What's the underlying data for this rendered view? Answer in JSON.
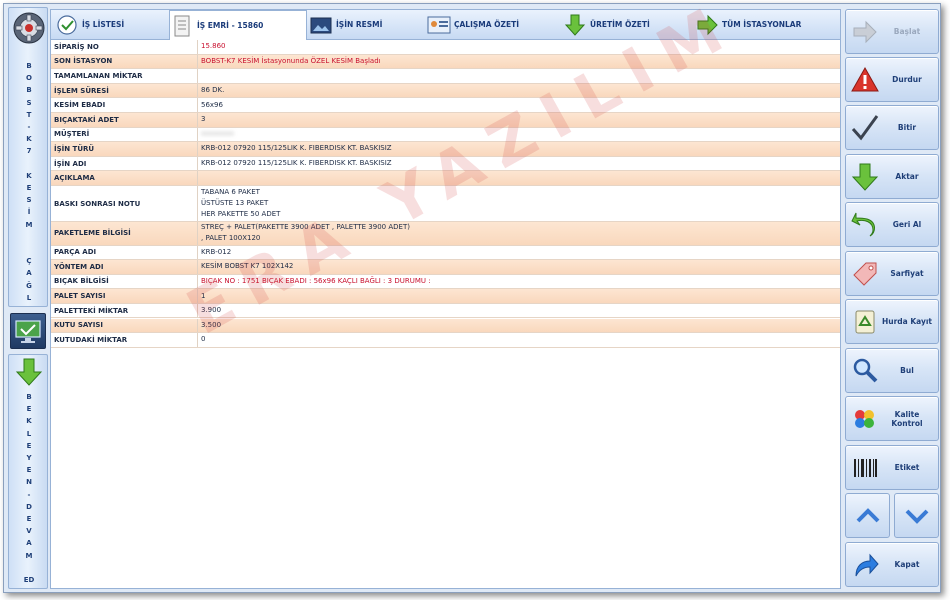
{
  "left_rail": {
    "top_text": "B\nO\nB\nS\nT\n-\nK\n7\n\nK\nE\nS\nİ\nM\n\n\nÇ\nA\nĞ\nL",
    "bottom_text": "B\nE\nK\nL\nE\nY\nE\nN\n-\nD\nE\nV\nA\nM\n\nED"
  },
  "tabs": [
    {
      "label": "İŞ LİSTESİ",
      "icon": "clipboard-check-icon"
    },
    {
      "label": "İŞ EMRİ - 15860",
      "icon": "document-icon",
      "active": true
    },
    {
      "label": "İŞİN RESMİ",
      "icon": "picture-icon"
    },
    {
      "label": "ÇALIŞMA ÖZETİ",
      "icon": "id-card-icon"
    },
    {
      "label": "ÜRETİM ÖZETİ",
      "icon": "down-arrow-icon"
    },
    {
      "label": "TÜM İSTASYONLAR",
      "icon": "right-arrow-icon"
    }
  ],
  "rows": [
    {
      "label": "SİPARİŞ NO",
      "value": [
        "15.860"
      ],
      "red": true
    },
    {
      "label": "SON İSTASYON",
      "value": [
        "BOBST-K7 KESİM İstasyonunda ÖZEL KESİM Başladı"
      ],
      "red": true
    },
    {
      "label": "TAMAMLANAN MİKTAR",
      "value": [
        ""
      ]
    },
    {
      "label": "İŞLEM SÜRESİ",
      "value": [
        "86 DK."
      ]
    },
    {
      "label": "KESİM EBADI",
      "value": [
        "56x96"
      ]
    },
    {
      "label": "BIÇAKTAKİ ADET",
      "value": [
        "3"
      ]
    },
    {
      "label": "MÜŞTERİ",
      "value": [
        "••••••••"
      ],
      "blurred": true
    },
    {
      "label": "İŞİN TÜRÜ",
      "value": [
        "KRB-012 07920 115/125LIK K. FIBERDISK KT. BASKISIZ"
      ]
    },
    {
      "label": "İŞİN ADI",
      "value": [
        "KRB-012 07920 115/125LIK K. FIBERDISK KT. BASKISIZ"
      ]
    },
    {
      "label": "AÇIKLAMA",
      "value": [
        ""
      ]
    },
    {
      "label": "BASKI SONRASI NOTU",
      "value": [
        "TABANA 6 PAKET",
        "ÜSTÜSTE 13 PAKET",
        "HER PAKETTE 50 ADET"
      ]
    },
    {
      "label": "PAKETLEME BİLGİSİ",
      "value": [
        "STREÇ + PALET(PAKETTE 3900 ADET , PALETTE 3900 ADET)",
        " , PALET 100X120"
      ]
    },
    {
      "label": "PARÇA ADI",
      "value": [
        "KRB-012"
      ]
    },
    {
      "label": "YÖNTEM ADI",
      "value": [
        "KESİM BOBST K7 102X142"
      ]
    },
    {
      "label": "BIÇAK BİLGİSİ",
      "value": [
        "BIÇAK NO : 1751 BIÇAK EBADI : 56x96 KAÇLI BAĞLI : 3 DURUMU :"
      ],
      "red": true
    },
    {
      "label": "PALET SAYISI",
      "value": [
        "1"
      ]
    },
    {
      "label": "PALETTEKİ MİKTAR",
      "value": [
        "3.900"
      ]
    },
    {
      "label": "KUTU SAYISI",
      "value": [
        "3.500"
      ]
    },
    {
      "label": "KUTUDAKİ MİKTAR",
      "value": [
        "0"
      ]
    }
  ],
  "watermark": "ERA YAZILIM",
  "buttons": [
    {
      "label": "Başlat",
      "icon": "right-arrow-icon",
      "disabled": true
    },
    {
      "label": "Durdur",
      "icon": "warning-icon"
    },
    {
      "label": "Bitir",
      "icon": "checkmark-icon"
    },
    {
      "label": "Aktar",
      "icon": "down-arrow-icon"
    },
    {
      "label": "Geri Al",
      "icon": "undo-icon"
    },
    {
      "label": "Sarfiyat",
      "icon": "tag-icon"
    },
    {
      "label": "Hurda Kayıt",
      "icon": "recycle-icon"
    },
    {
      "label": "Bul",
      "icon": "magnifier-icon"
    },
    {
      "label": "Kalite Kontrol",
      "icon": "color-dots-icon"
    },
    {
      "label": "Etiket",
      "icon": "barcode-icon"
    },
    {
      "label": "Kapat",
      "icon": "exit-arrow-icon"
    }
  ],
  "colors": {
    "accent": "#1f3f78",
    "red_text": "#c8102e",
    "row_alt": "#fde6d2",
    "watermark": "#d23c3c"
  }
}
